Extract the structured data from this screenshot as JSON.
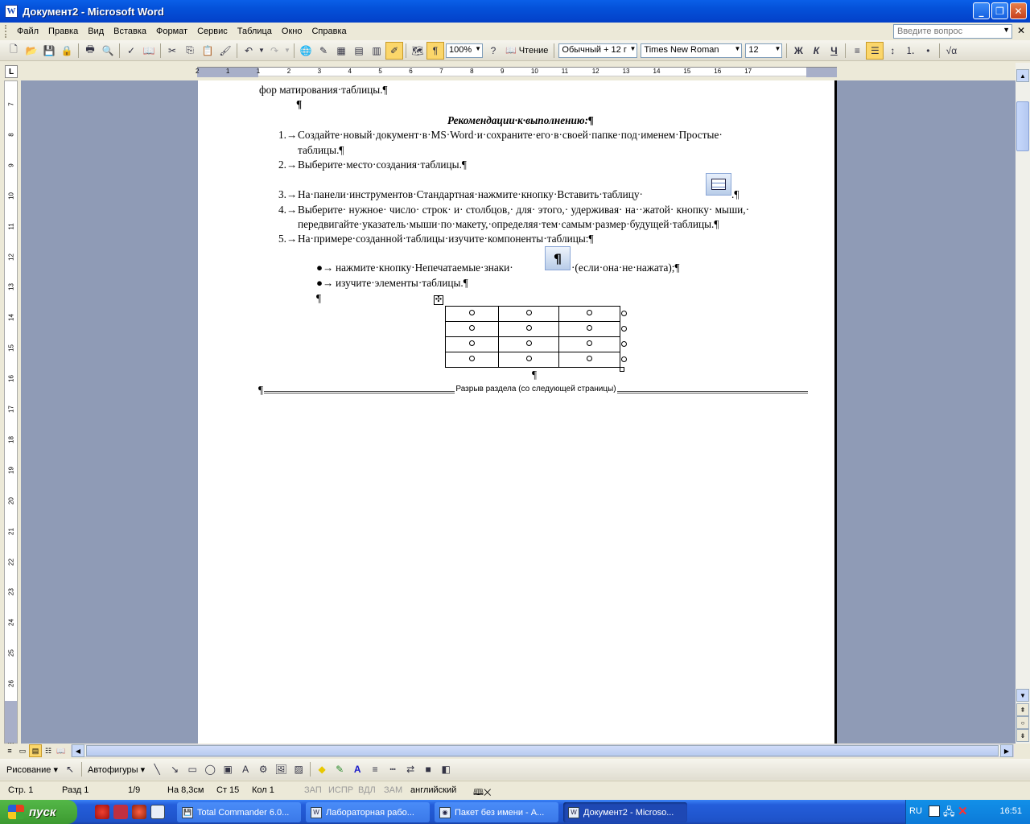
{
  "window": {
    "title": "Документ2 - Microsoft Word",
    "app_icon": "W"
  },
  "menu": {
    "items": [
      "Файл",
      "Правка",
      "Вид",
      "Вставка",
      "Формат",
      "Сервис",
      "Таблица",
      "Окно",
      "Справка"
    ],
    "help_placeholder": "Введите вопрос"
  },
  "toolbar": {
    "zoom": "100%",
    "reading_label": "Чтение",
    "style": "Обычный + 12 г",
    "font": "Times New Roman",
    "size": "12",
    "bold": "Ж",
    "italic": "К",
    "underline": "Ч",
    "formatting_marks_active": true
  },
  "ruler": {
    "h_numbers": [
      "2",
      "1",
      "1",
      "2",
      "3",
      "4",
      "5",
      "6",
      "7",
      "8",
      "9",
      "10",
      "11",
      "12",
      "13",
      "14",
      "15",
      "16",
      "17"
    ],
    "v_numbers": [
      "7",
      "8",
      "9",
      "10",
      "11",
      "12",
      "13",
      "14",
      "15",
      "16",
      "17",
      "18",
      "19",
      "20",
      "21",
      "22",
      "23",
      "24",
      "25",
      "26",
      "27",
      "28"
    ],
    "corner": "L"
  },
  "document": {
    "line_top": "фор матирования·таблицы.¶",
    "empty_mark": "¶",
    "heading": "Рекомендации·к·выполнению:¶",
    "steps": [
      {
        "num": "1.→",
        "text": "Создайте·новый·документ·в·MS·Word·и·сохраните·его·в·своей·папке·под·именем·Простые·",
        "cont": "таблицы.¶"
      },
      {
        "num": "2.→",
        "text": "Выберите·место·создания·таблицы.¶"
      },
      {
        "num": "3.→",
        "text": "На·панели·инструментов·Стандартная·нажмите·кнопку·Вставить·таблицу·",
        "tail": ".¶"
      },
      {
        "num": "4.→",
        "text": "Выберите· нужное· число· строк· и· столбцов,· для· этого,· удерживая· на··жатой· кнопку· мыши,·",
        "cont": "передвигайте·указатель·мыши·по·макету,·определяя·тем·самым·размер·будущей·таблицы.¶"
      },
      {
        "num": "5.→",
        "text": "На·примере·созданной·таблицы·изучите·компоненты·таблицы:¶"
      }
    ],
    "bullets": [
      {
        "mark": "●→",
        "text": "нажмите·кнопку·Непечатаемые·знаки·",
        "tail": "·(если·она·не·нажата);¶"
      },
      {
        "mark": "●→",
        "text": "изучите·элементы·таблицы.¶"
      }
    ],
    "pilcrow_icon": "¶",
    "after_bullets_mark": "¶",
    "below_table_mark": "¶",
    "table": {
      "rows": 4,
      "cols": 3
    },
    "section_break_mark": "¶",
    "section_break": "Разрыв раздела (со следующей страницы)"
  },
  "drawing": {
    "draw_label": "Рисование",
    "autoshapes_label": "Автофигуры"
  },
  "status": {
    "page": "Стр. 1",
    "section": "Разд 1",
    "pages": "1/9",
    "at": "На 8,3см",
    "line": "Ст 15",
    "col": "Кол 1",
    "rec": "ЗАП",
    "trk": "ИСПР",
    "ext": "ВДЛ",
    "ovr": "ЗАМ",
    "lang": "английский"
  },
  "taskbar": {
    "start": "пуск",
    "tasks": [
      "Total Commander 6.0...",
      "Лабораторная рабо...",
      "Пакет без имени - A...",
      "Документ2 - Microso..."
    ],
    "lang": "RU",
    "time": "16:51"
  },
  "colors": {
    "title_blue": "#0450d8",
    "page_bg": "#8f9bb6",
    "active_yellow": "#fbd66a",
    "taskbar_blue": "#245edb",
    "start_green": "#3c9a30"
  }
}
